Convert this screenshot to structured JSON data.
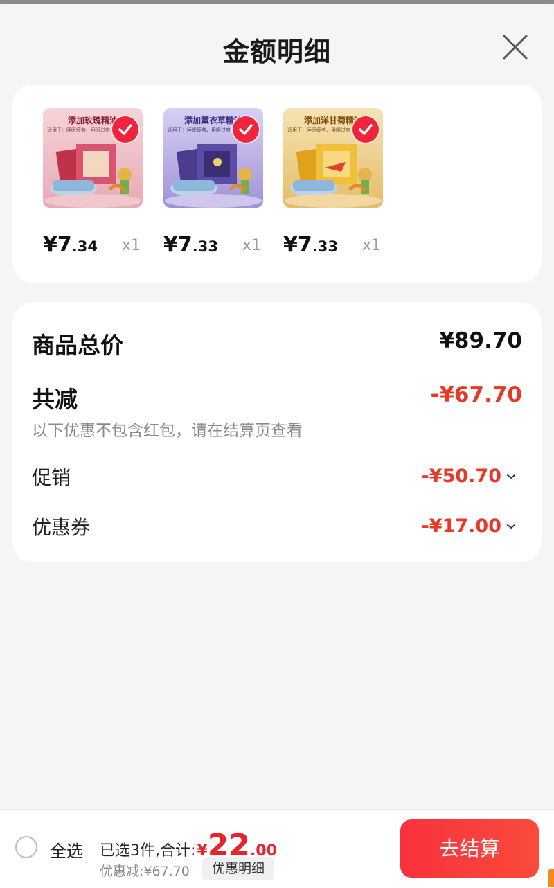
{
  "header": {
    "title": "金额明细",
    "close_icon": "close-icon"
  },
  "products": [
    {
      "banner": "添加玫瑰精油",
      "subtitle": "适用于：睡眠疲劳、用眼过度",
      "price_int": "¥7",
      "price_dec": ".34",
      "qty": "x1",
      "selected": true,
      "theme": "rose"
    },
    {
      "banner": "添加薰衣草精油",
      "subtitle": "适用于：睡眠疲劳、用眼过度",
      "price_int": "¥7",
      "price_dec": ".33",
      "qty": "x1",
      "selected": true,
      "theme": "lavender"
    },
    {
      "banner": "添加洋甘菊精油",
      "subtitle": "适用于：睡眠疲劳、用眼过度",
      "price_int": "¥7",
      "price_dec": ".33",
      "qty": "x1",
      "selected": true,
      "theme": "chamomile"
    }
  ],
  "summary": {
    "total_label": "商品总价",
    "total_value": "¥89.70",
    "reduce_label": "共减",
    "reduce_value": "-¥67.70",
    "note": "以下优惠不包含红包，请在结算页查看",
    "promo_label": "促销",
    "promo_value": "-¥50.70",
    "coupon_label": "优惠券",
    "coupon_value": "-¥17.00"
  },
  "bottom_bar": {
    "select_all_label": "全选",
    "selected_text": "已选3件,合计:",
    "currency": "¥",
    "total_int": "22",
    "total_dec": ".00",
    "discount_text": "优惠减:¥67.70",
    "detail_button": "优惠明细",
    "checkout_button": "去结算"
  },
  "colors": {
    "accent_red": "#e83828",
    "checkout_red": "#f7323c",
    "check_red": "#f0243c"
  }
}
